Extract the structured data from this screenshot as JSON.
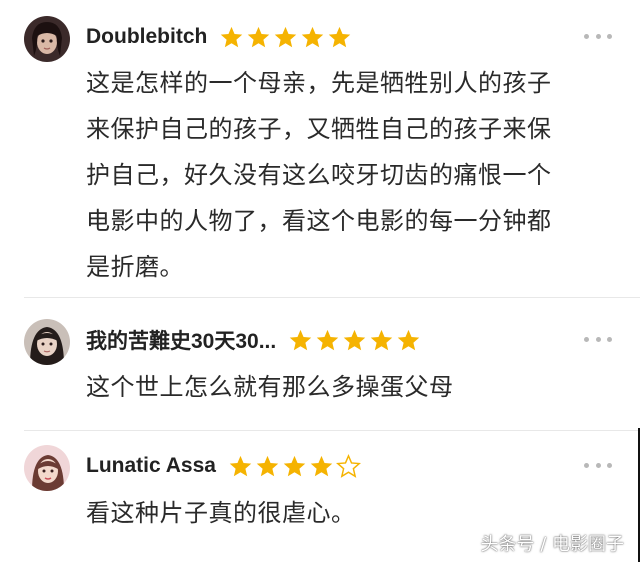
{
  "colors": {
    "star_filled": "#f5b301",
    "star_empty_outline": "#f5b301",
    "text": "#2a2a2a",
    "more_dots": "#b8b8b8"
  },
  "reviews": [
    {
      "username": "Doublebitch",
      "rating": 5,
      "max_rating": 5,
      "avatar_icon": "avatar-dark-hair-portrait",
      "more_icon": "more-dots-icon",
      "text_lines": [
        "这是怎样的一个母亲，先是牺牲别人的孩子",
        "来保护自己的孩子，又牺牲自己的孩子来保",
        "护自己，好久没有这么咬牙切齿的痛恨一个",
        "电影中的人物了，看这个电影的每一分钟都",
        "是折磨。"
      ]
    },
    {
      "username": "我的苦難史30天30...",
      "rating": 5,
      "max_rating": 5,
      "avatar_icon": "avatar-girl-portrait",
      "more_icon": "more-dots-icon",
      "text_lines": [
        "这个世上怎么就有那么多操蛋父母"
      ]
    },
    {
      "username": "Lunatic Assa",
      "rating": 4,
      "max_rating": 5,
      "avatar_icon": "avatar-pink-portrait",
      "more_icon": "more-dots-icon",
      "text_lines": [
        "看这种片子真的很虐心。"
      ]
    }
  ],
  "watermark": "头条号 / 电影圈子"
}
